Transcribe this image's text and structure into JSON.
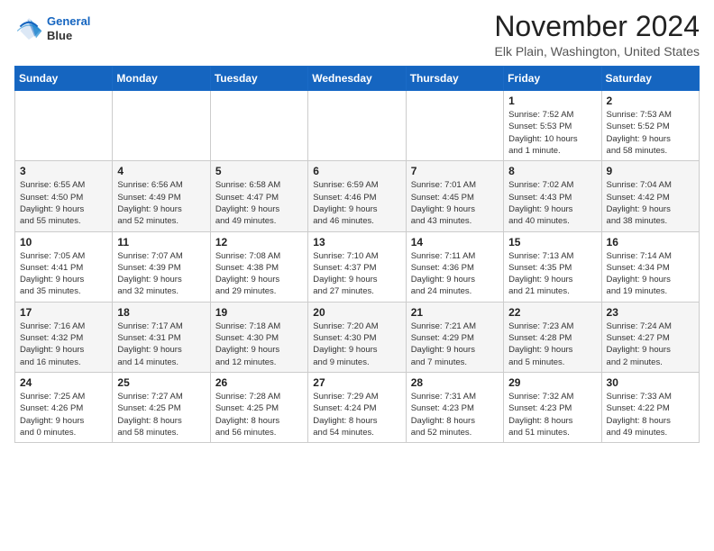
{
  "logo": {
    "line1": "General",
    "line2": "Blue"
  },
  "title": "November 2024",
  "location": "Elk Plain, Washington, United States",
  "weekdays": [
    "Sunday",
    "Monday",
    "Tuesday",
    "Wednesday",
    "Thursday",
    "Friday",
    "Saturday"
  ],
  "weeks": [
    [
      {
        "day": "",
        "info": ""
      },
      {
        "day": "",
        "info": ""
      },
      {
        "day": "",
        "info": ""
      },
      {
        "day": "",
        "info": ""
      },
      {
        "day": "",
        "info": ""
      },
      {
        "day": "1",
        "info": "Sunrise: 7:52 AM\nSunset: 5:53 PM\nDaylight: 10 hours\nand 1 minute."
      },
      {
        "day": "2",
        "info": "Sunrise: 7:53 AM\nSunset: 5:52 PM\nDaylight: 9 hours\nand 58 minutes."
      }
    ],
    [
      {
        "day": "3",
        "info": "Sunrise: 6:55 AM\nSunset: 4:50 PM\nDaylight: 9 hours\nand 55 minutes."
      },
      {
        "day": "4",
        "info": "Sunrise: 6:56 AM\nSunset: 4:49 PM\nDaylight: 9 hours\nand 52 minutes."
      },
      {
        "day": "5",
        "info": "Sunrise: 6:58 AM\nSunset: 4:47 PM\nDaylight: 9 hours\nand 49 minutes."
      },
      {
        "day": "6",
        "info": "Sunrise: 6:59 AM\nSunset: 4:46 PM\nDaylight: 9 hours\nand 46 minutes."
      },
      {
        "day": "7",
        "info": "Sunrise: 7:01 AM\nSunset: 4:45 PM\nDaylight: 9 hours\nand 43 minutes."
      },
      {
        "day": "8",
        "info": "Sunrise: 7:02 AM\nSunset: 4:43 PM\nDaylight: 9 hours\nand 40 minutes."
      },
      {
        "day": "9",
        "info": "Sunrise: 7:04 AM\nSunset: 4:42 PM\nDaylight: 9 hours\nand 38 minutes."
      }
    ],
    [
      {
        "day": "10",
        "info": "Sunrise: 7:05 AM\nSunset: 4:41 PM\nDaylight: 9 hours\nand 35 minutes."
      },
      {
        "day": "11",
        "info": "Sunrise: 7:07 AM\nSunset: 4:39 PM\nDaylight: 9 hours\nand 32 minutes."
      },
      {
        "day": "12",
        "info": "Sunrise: 7:08 AM\nSunset: 4:38 PM\nDaylight: 9 hours\nand 29 minutes."
      },
      {
        "day": "13",
        "info": "Sunrise: 7:10 AM\nSunset: 4:37 PM\nDaylight: 9 hours\nand 27 minutes."
      },
      {
        "day": "14",
        "info": "Sunrise: 7:11 AM\nSunset: 4:36 PM\nDaylight: 9 hours\nand 24 minutes."
      },
      {
        "day": "15",
        "info": "Sunrise: 7:13 AM\nSunset: 4:35 PM\nDaylight: 9 hours\nand 21 minutes."
      },
      {
        "day": "16",
        "info": "Sunrise: 7:14 AM\nSunset: 4:34 PM\nDaylight: 9 hours\nand 19 minutes."
      }
    ],
    [
      {
        "day": "17",
        "info": "Sunrise: 7:16 AM\nSunset: 4:32 PM\nDaylight: 9 hours\nand 16 minutes."
      },
      {
        "day": "18",
        "info": "Sunrise: 7:17 AM\nSunset: 4:31 PM\nDaylight: 9 hours\nand 14 minutes."
      },
      {
        "day": "19",
        "info": "Sunrise: 7:18 AM\nSunset: 4:30 PM\nDaylight: 9 hours\nand 12 minutes."
      },
      {
        "day": "20",
        "info": "Sunrise: 7:20 AM\nSunset: 4:30 PM\nDaylight: 9 hours\nand 9 minutes."
      },
      {
        "day": "21",
        "info": "Sunrise: 7:21 AM\nSunset: 4:29 PM\nDaylight: 9 hours\nand 7 minutes."
      },
      {
        "day": "22",
        "info": "Sunrise: 7:23 AM\nSunset: 4:28 PM\nDaylight: 9 hours\nand 5 minutes."
      },
      {
        "day": "23",
        "info": "Sunrise: 7:24 AM\nSunset: 4:27 PM\nDaylight: 9 hours\nand 2 minutes."
      }
    ],
    [
      {
        "day": "24",
        "info": "Sunrise: 7:25 AM\nSunset: 4:26 PM\nDaylight: 9 hours\nand 0 minutes."
      },
      {
        "day": "25",
        "info": "Sunrise: 7:27 AM\nSunset: 4:25 PM\nDaylight: 8 hours\nand 58 minutes."
      },
      {
        "day": "26",
        "info": "Sunrise: 7:28 AM\nSunset: 4:25 PM\nDaylight: 8 hours\nand 56 minutes."
      },
      {
        "day": "27",
        "info": "Sunrise: 7:29 AM\nSunset: 4:24 PM\nDaylight: 8 hours\nand 54 minutes."
      },
      {
        "day": "28",
        "info": "Sunrise: 7:31 AM\nSunset: 4:23 PM\nDaylight: 8 hours\nand 52 minutes."
      },
      {
        "day": "29",
        "info": "Sunrise: 7:32 AM\nSunset: 4:23 PM\nDaylight: 8 hours\nand 51 minutes."
      },
      {
        "day": "30",
        "info": "Sunrise: 7:33 AM\nSunset: 4:22 PM\nDaylight: 8 hours\nand 49 minutes."
      }
    ]
  ]
}
